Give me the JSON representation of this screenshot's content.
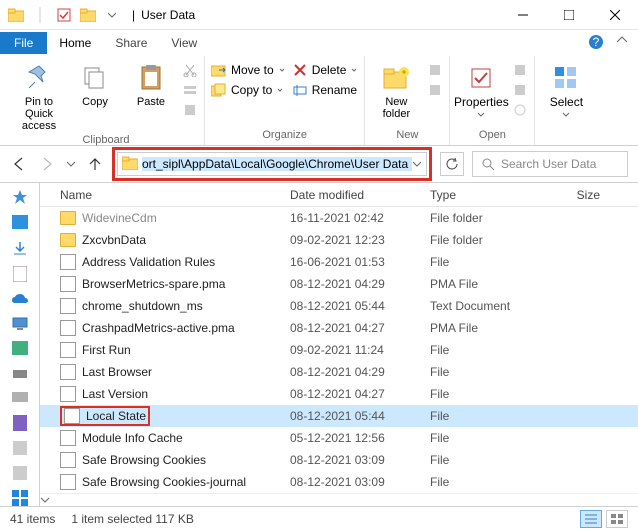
{
  "window": {
    "title": "User Data"
  },
  "tabs": {
    "file": "File",
    "home": "Home",
    "share": "Share",
    "view": "View"
  },
  "ribbon": {
    "pin_to_quick": "Pin to Quick access",
    "copy": "Copy",
    "paste": "Paste",
    "clipboard": "Clipboard",
    "move_to": "Move to",
    "copy_to": "Copy to",
    "delete": "Delete",
    "rename": "Rename",
    "organize": "Organize",
    "new_folder": "New folder",
    "new": "New",
    "properties": "Properties",
    "open": "Open",
    "select": "Select"
  },
  "address": {
    "value": "ort_sipl\\AppData\\Local\\Google\\Chrome\\User Data"
  },
  "search": {
    "placeholder": "Search User Data"
  },
  "columns": {
    "name": "Name",
    "date": "Date modified",
    "type": "Type",
    "size": "Size"
  },
  "rows": [
    {
      "name": "WidevineCdm",
      "date": "16-11-2021 02:42",
      "type": "File folder",
      "kind": "folder",
      "dim": true
    },
    {
      "name": "ZxcvbnData",
      "date": "09-02-2021 12:23",
      "type": "File folder",
      "kind": "folder"
    },
    {
      "name": "Address Validation Rules",
      "date": "16-06-2021 01:53",
      "type": "File",
      "kind": "file"
    },
    {
      "name": "BrowserMetrics-spare.pma",
      "date": "08-12-2021 04:29",
      "type": "PMA File",
      "kind": "file"
    },
    {
      "name": "chrome_shutdown_ms",
      "date": "08-12-2021 05:44",
      "type": "Text Document",
      "kind": "file"
    },
    {
      "name": "CrashpadMetrics-active.pma",
      "date": "08-12-2021 04:27",
      "type": "PMA File",
      "kind": "file"
    },
    {
      "name": "First Run",
      "date": "09-02-2021 11:24",
      "type": "File",
      "kind": "file"
    },
    {
      "name": "Last Browser",
      "date": "08-12-2021 04:29",
      "type": "File",
      "kind": "file"
    },
    {
      "name": "Last Version",
      "date": "08-12-2021 04:27",
      "type": "File",
      "kind": "file"
    },
    {
      "name": "Local State",
      "date": "08-12-2021 05:44",
      "type": "File",
      "kind": "file",
      "selected": true,
      "highlight": true
    },
    {
      "name": "Module Info Cache",
      "date": "05-12-2021 12:56",
      "type": "File",
      "kind": "file"
    },
    {
      "name": "Safe Browsing Cookies",
      "date": "08-12-2021 03:09",
      "type": "File",
      "kind": "file"
    },
    {
      "name": "Safe Browsing Cookies-journal",
      "date": "08-12-2021 03:09",
      "type": "File",
      "kind": "file"
    }
  ],
  "status": {
    "items": "41 items",
    "selected": "1 item selected  117 KB"
  }
}
